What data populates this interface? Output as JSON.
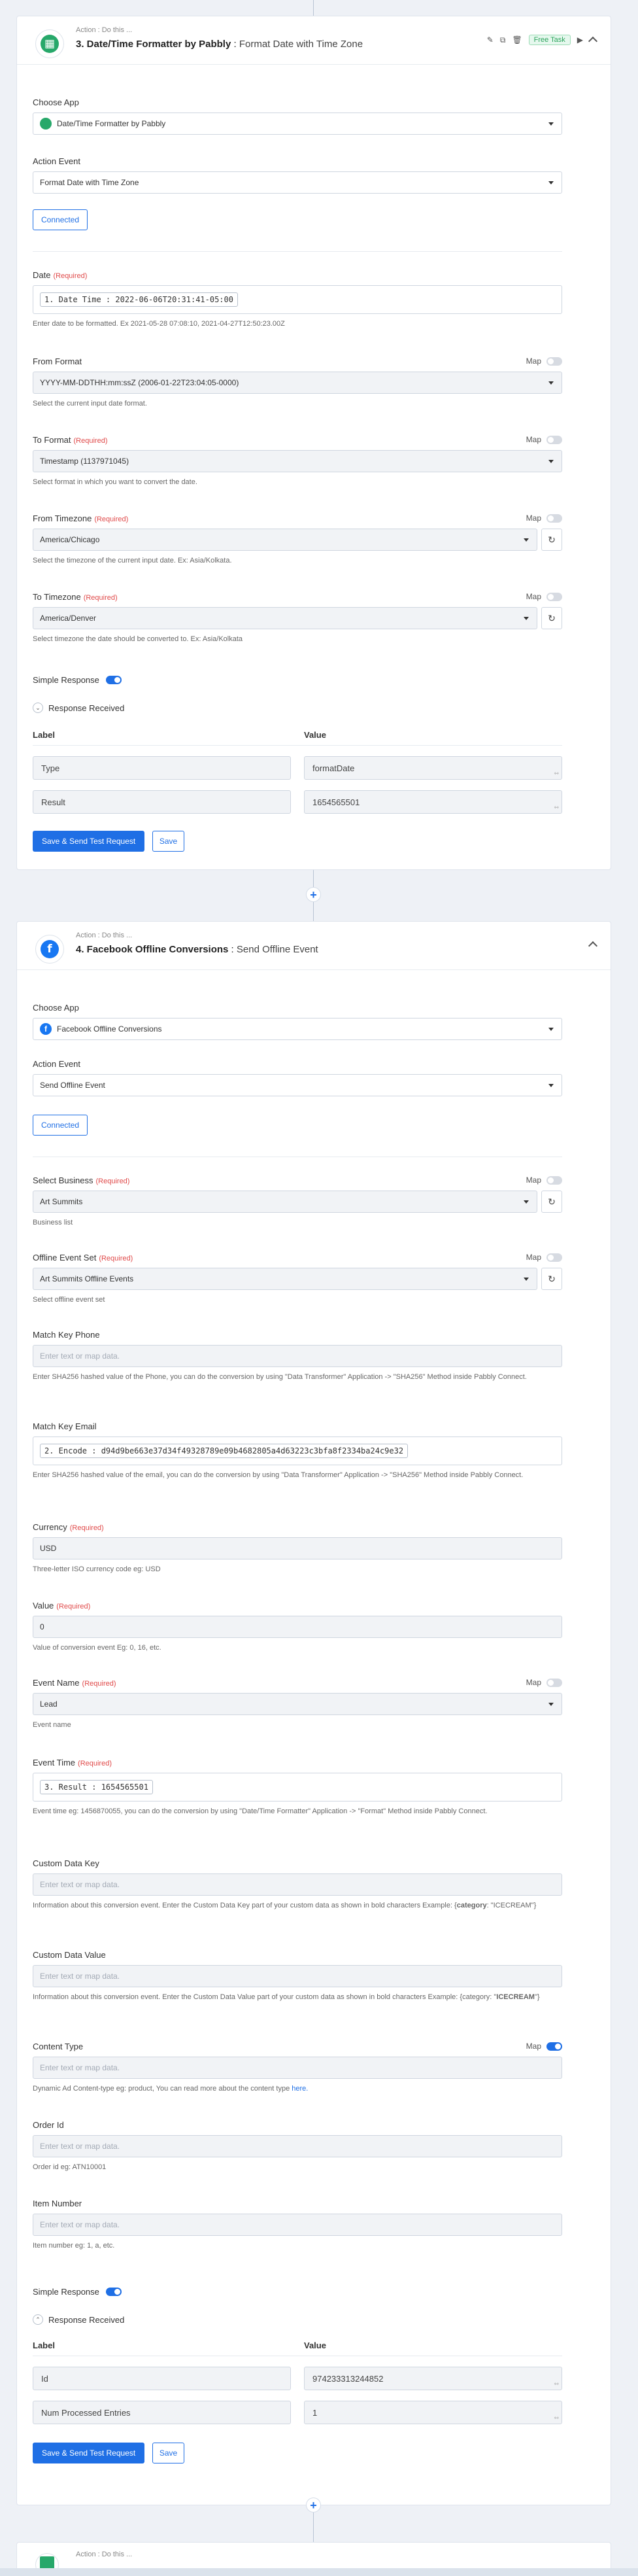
{
  "step3": {
    "action_sub": "Action : Do this ...",
    "title_num": "3. Date/Time Formatter by Pabbly",
    "title_sep": " : ",
    "title_event": "Format Date with Time Zone",
    "badge": "Free Task",
    "choose_app_label": "Choose App",
    "choose_app_value": "Date/Time Formatter by Pabbly",
    "action_event_label": "Action Event",
    "action_event_value": "Format Date with Time Zone",
    "connected_label": "Connected",
    "date_label": "Date",
    "required": "(Required)",
    "date_token": "1. Date Time : 2022-06-06T20:31:41-05:00",
    "date_help": "Enter date to be formatted. Ex 2021-05-28 07:08:10, 2021-04-27T12:50:23.00Z",
    "from_format_label": "From Format",
    "map_label": "Map",
    "from_format_value": "YYYY-MM-DDTHH:mm:ssZ (2006-01-22T23:04:05-0000)",
    "from_format_help": "Select the current input date format.",
    "to_format_label": "To Format",
    "to_format_value": "Timestamp (1137971045)",
    "to_format_help": "Select format in which you want to convert the date.",
    "from_tz_label": "From Timezone",
    "from_tz_value": "America/Chicago",
    "from_tz_help": "Select the timezone of the current input date. Ex: Asia/Kolkata.",
    "to_tz_label": "To Timezone",
    "to_tz_value": "America/Denver",
    "to_tz_help": "Select timezone the date should be converted to. Ex: Asia/Kolkata",
    "simple_response_label": "Simple Response",
    "response_received_label": "Response Received",
    "col_label": "Label",
    "col_value": "Value",
    "rows": [
      {
        "label": "Type",
        "value": "formatDate"
      },
      {
        "label": "Result",
        "value": "1654565501"
      }
    ],
    "save_test_label": "Save & Send Test Request",
    "save_label": "Save"
  },
  "step4": {
    "action_sub": "Action : Do this ...",
    "title_num": "4. Facebook Offline Conversions",
    "title_sep": " : ",
    "title_event": "Send Offline Event",
    "choose_app_label": "Choose App",
    "choose_app_value": "Facebook Offline Conversions",
    "action_event_label": "Action Event",
    "action_event_value": "Send Offline Event",
    "connected_label": "Connected",
    "required": "(Required)",
    "map_label": "Map",
    "business_label": "Select Business",
    "business_value": "Art Summits",
    "business_help": "Business list",
    "event_set_label": "Offline Event Set",
    "event_set_value": "Art Summits Offline Events",
    "event_set_help": "Select offline event set",
    "phone_label": "Match Key Phone",
    "phone_placeholder": "Enter text or map data.",
    "phone_help": "Enter SHA256 hashed value of the Phone, you can do the conversion by using \"Data Transformer\" Application -> \"SHA256\" Method inside Pabbly Connect.",
    "email_label": "Match Key Email",
    "email_token": "2. Encode : d94d9be663e37d34f49328789e09b4682805a4d63223c3bfa8f2334ba24c9e32",
    "email_help": "Enter SHA256 hashed value of the email, you can do the conversion by using \"Data Transformer\" Application -> \"SHA256\" Method inside Pabbly Connect.",
    "currency_label": "Currency",
    "currency_value": "USD",
    "currency_help": "Three-letter ISO currency code eg: USD",
    "value_label": "Value",
    "value_value": "0",
    "value_help": "Value of conversion event Eg: 0, 16, etc.",
    "event_name_label": "Event Name",
    "event_name_value": "Lead",
    "event_name_help": "Event name",
    "event_time_label": "Event Time",
    "event_time_token": "3. Result : 1654565501",
    "event_time_help": "Event time eg: 1456870055, you can do the conversion by using \"Date/Time Formatter\" Application -> \"Format\" Method inside Pabbly Connect.",
    "cd_key_label": "Custom Data Key",
    "cd_key_placeholder": "Enter text or map data.",
    "cd_key_help_a": "Information about this conversion event. Enter the Custom Data Key part of your custom data as shown in bold characters Example: {",
    "cd_key_help_b": "category",
    "cd_key_help_c": ": \"ICECREAM\"}",
    "cd_val_label": "Custom Data Value",
    "cd_val_placeholder": "Enter text or map data.",
    "cd_val_help_a": "Information about this conversion event. Enter the Custom Data Value part of your custom data as shown in bold characters Example: {category: \"",
    "cd_val_help_b": "ICECREAM",
    "cd_val_help_c": "\"}",
    "content_type_label": "Content Type",
    "content_type_placeholder": "Enter text or map data.",
    "content_type_help": "Dynamic Ad Content-type eg: product, You can read more about the content type ",
    "content_type_link": "here.",
    "order_label": "Order Id",
    "order_placeholder": "Enter text or map data.",
    "order_help": "Order id eg: ATN10001",
    "item_label": "Item Number",
    "item_placeholder": "Enter text or map data.",
    "item_help": "Item number eg: 1, a, etc.",
    "simple_response_label": "Simple Response",
    "response_received_label": "Response Received",
    "col_label": "Label",
    "col_value": "Value",
    "rows": [
      {
        "label": "Id",
        "value": "974233313244852"
      },
      {
        "label": "Num Processed Entries",
        "value": "1"
      }
    ],
    "save_test_label": "Save & Send Test Request",
    "save_label": "Save"
  },
  "step5": {
    "action_sub": "Action : Do this ..."
  },
  "colors": {
    "accent": "#1f6fe5",
    "required": "#e04a4a",
    "success": "#2aa35b",
    "pabbly_green": "#27a86a",
    "facebook_blue": "#1877f2"
  }
}
